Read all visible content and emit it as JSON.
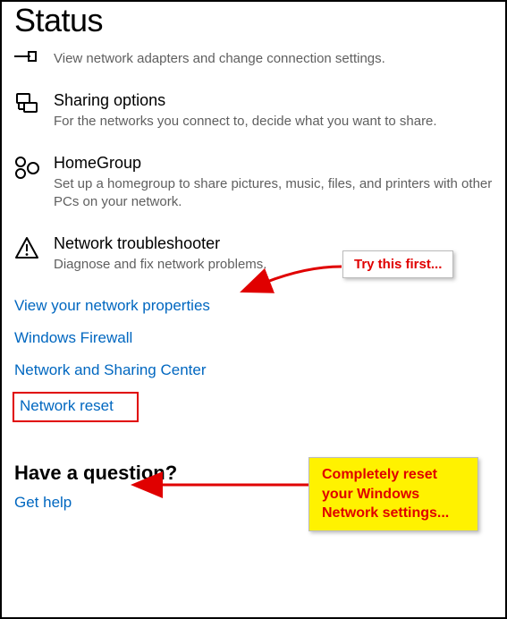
{
  "page": {
    "title": "Status"
  },
  "items": [
    {
      "title": "",
      "desc": "View network adapters and change connection settings."
    },
    {
      "title": "Sharing options",
      "desc": "For the networks you connect to, decide what you want to share."
    },
    {
      "title": "HomeGroup",
      "desc": "Set up a homegroup to share pictures, music, files, and printers with other PCs on your network."
    },
    {
      "title": "Network troubleshooter",
      "desc": "Diagnose and fix network problems."
    }
  ],
  "links": {
    "properties": "View your network properties",
    "firewall": "Windows Firewall",
    "sharing_center": "Network and Sharing Center",
    "network_reset": "Network reset"
  },
  "question": {
    "heading": "Have a question?",
    "get_help": "Get help"
  },
  "callouts": {
    "try_first": "Try this first...",
    "reset_all": "Completely reset your Windows Network settings..."
  }
}
